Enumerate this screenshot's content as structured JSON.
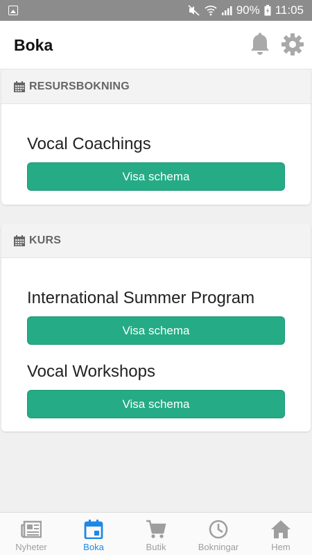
{
  "status_bar": {
    "battery": "90%",
    "time": "11:05",
    "icons": [
      "image-icon",
      "mute-icon",
      "wifi-icon",
      "signal-icon",
      "battery-icon"
    ]
  },
  "app_bar": {
    "title": "Boka",
    "icons": [
      "bell-icon",
      "gear-icon"
    ]
  },
  "sections": [
    {
      "label": "RESURSBOKNING",
      "icon": "calendar-icon",
      "items": [
        {
          "title": "Vocal Coachings",
          "button": "Visa schema"
        }
      ]
    },
    {
      "label": "KURS",
      "icon": "calendar-icon",
      "items": [
        {
          "title": "International Summer Program",
          "button": "Visa schema"
        },
        {
          "title": "Vocal Workshops",
          "button": "Visa schema"
        }
      ]
    }
  ],
  "bottom_nav": {
    "active": "Boka",
    "items": [
      {
        "label": "Nyheter",
        "icon": "newspaper-icon"
      },
      {
        "label": "Boka",
        "icon": "calendar-icon"
      },
      {
        "label": "Butik",
        "icon": "cart-icon"
      },
      {
        "label": "Bokningar",
        "icon": "clock-icon"
      },
      {
        "label": "Hem",
        "icon": "home-icon"
      }
    ]
  },
  "colors": {
    "button": "#25ab85",
    "active_nav": "#1e88e5",
    "status_bar": "#8c8c8c"
  }
}
